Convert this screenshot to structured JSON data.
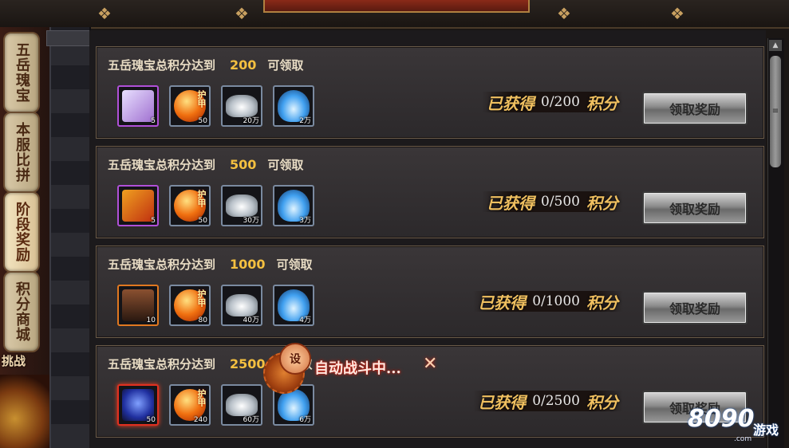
{
  "side_tabs": [
    {
      "label": "五岳瑰宝",
      "active": false
    },
    {
      "label": "本服比拼",
      "active": false
    },
    {
      "label": "阶段奖励",
      "active": true
    },
    {
      "label": "积分商城",
      "active": false
    }
  ],
  "side_challenge_text": "挑战",
  "rewards": [
    {
      "title_prefix": "五岳瑰宝总积分达到",
      "threshold": "200",
      "title_suffix": "可领取",
      "items": [
        {
          "icon": "rune-card-icon",
          "count": "5",
          "tag": ""
        },
        {
          "icon": "armor-orb-icon",
          "count": "50",
          "tag": "护甲"
        },
        {
          "icon": "silver-ingot-icon",
          "count": "20万",
          "tag": ""
        },
        {
          "icon": "blue-flame-icon",
          "count": "2万",
          "tag": ""
        }
      ],
      "progress_label": "已获得",
      "progress_value": "0/200",
      "progress_unit": "积分",
      "button_label": "领取奖励"
    },
    {
      "title_prefix": "五岳瑰宝总积分达到",
      "threshold": "500",
      "title_suffix": "可领取",
      "items": [
        {
          "icon": "rune-card-icon",
          "count": "5",
          "tag": ""
        },
        {
          "icon": "armor-orb-icon",
          "count": "50",
          "tag": "护甲"
        },
        {
          "icon": "silver-ingot-icon",
          "count": "30万",
          "tag": ""
        },
        {
          "icon": "blue-flame-icon",
          "count": "3万",
          "tag": ""
        }
      ],
      "progress_label": "已获得",
      "progress_value": "0/500",
      "progress_unit": "积分",
      "button_label": "领取奖励"
    },
    {
      "title_prefix": "五岳瑰宝总积分达到",
      "threshold": "1000",
      "title_suffix": "可领取",
      "items": [
        {
          "icon": "hero-portrait-icon",
          "count": "10",
          "tag": ""
        },
        {
          "icon": "armor-orb-icon",
          "count": "80",
          "tag": "护甲"
        },
        {
          "icon": "silver-ingot-icon",
          "count": "40万",
          "tag": ""
        },
        {
          "icon": "blue-flame-icon",
          "count": "4万",
          "tag": ""
        }
      ],
      "progress_label": "已获得",
      "progress_value": "0/1000",
      "progress_unit": "积分",
      "button_label": "领取奖励"
    },
    {
      "title_prefix": "五岳瑰宝总积分达到",
      "threshold": "2500",
      "title_suffix": "可领取",
      "items": [
        {
          "icon": "blue-gem-icon",
          "count": "50",
          "tag": ""
        },
        {
          "icon": "armor-orb-icon",
          "count": "240",
          "tag": "护甲"
        },
        {
          "icon": "silver-ingot-icon",
          "count": "60万",
          "tag": ""
        },
        {
          "icon": "blue-flame-icon",
          "count": "6万",
          "tag": ""
        }
      ],
      "progress_label": "已获得",
      "progress_value": "0/2500",
      "progress_unit": "积分",
      "button_label": "领取奖励"
    }
  ],
  "auto_battle": {
    "gear_label": "设",
    "text": "自动战斗中...",
    "close_symbol": "✕"
  },
  "watermark": {
    "number": "8090",
    "text": "游戏",
    "domain": ".com"
  }
}
